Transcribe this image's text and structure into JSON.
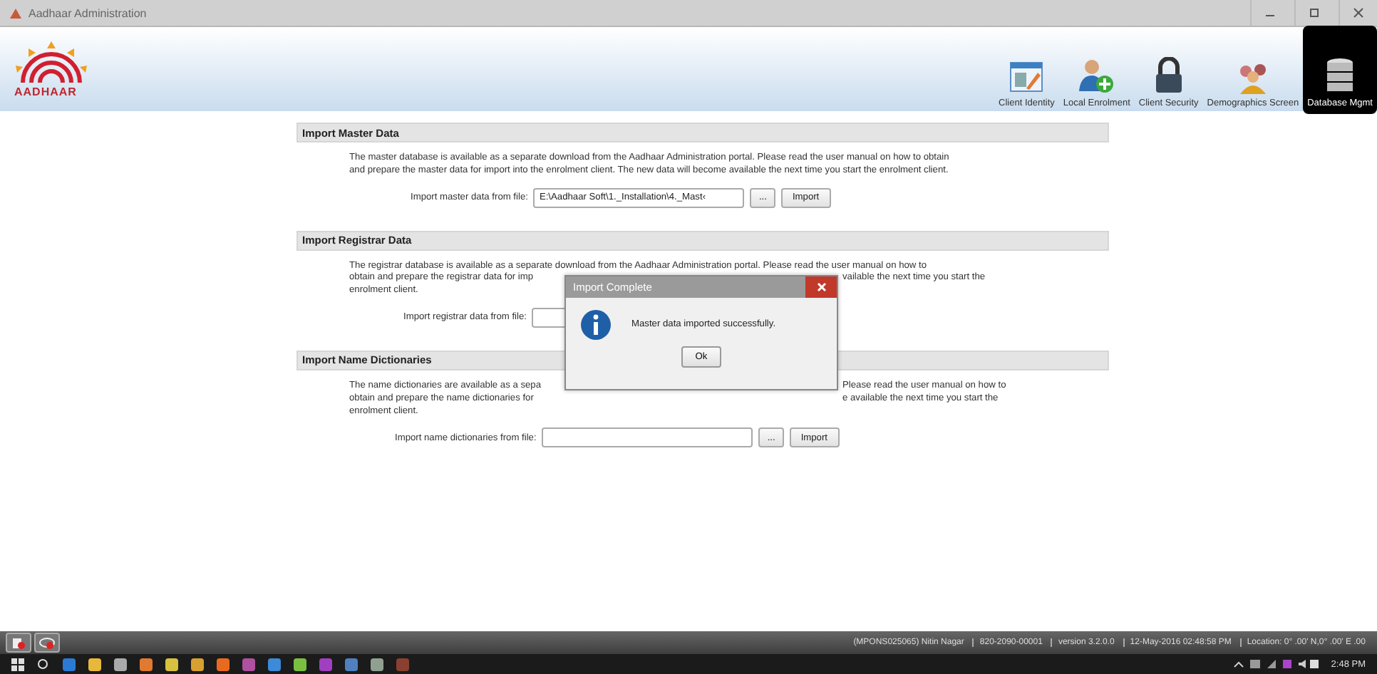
{
  "window": {
    "title": "Aadhaar Administration"
  },
  "logo": {
    "text": "AADHAAR"
  },
  "nav": [
    {
      "label": "Client Identity",
      "selected": false
    },
    {
      "label": "Local Enrolment",
      "selected": false
    },
    {
      "label": "Client Security",
      "selected": false
    },
    {
      "label": "Demographics Screen",
      "selected": false
    },
    {
      "label": "Database Mgmt",
      "selected": true
    }
  ],
  "sections": [
    {
      "title": "Import Master Data",
      "lines": [
        {
          "left": "The master database is available as a separate download from the Aadhaar Administration portal. Please read the user manual on how to obtain"
        },
        {
          "left": "and prepare the master data for import into the enrolment client. The new data will become available the next time you start the enrolment client."
        }
      ],
      "field_label": "Import master data from file:",
      "field_value": "E:\\Aadhaar Soft\\1._Installation\\4._Mast‹",
      "browse": "...",
      "import": "Import"
    },
    {
      "title": "Import Registrar Data",
      "lines": [
        {
          "left": "The registrar database is available as a separate download from the Aadhaar Administration portal. Please read the user manual on how to"
        },
        {
          "left": "obtain and prepare the registrar data for imp",
          "right": "vailable the next time you start the"
        },
        {
          "left": "enrolment client."
        }
      ],
      "field_label": "Import registrar data from file:"
    },
    {
      "title": "Import Name Dictionaries",
      "lines": [
        {
          "left": "The name dictionaries are available as a sepa",
          "right": "Please read the user manual on how to"
        },
        {
          "left": "obtain and prepare the name dictionaries for",
          "right": "e available the next time you start the"
        },
        {
          "left": "enrolment client."
        }
      ],
      "field_label": "Import name dictionaries from file:",
      "browse": "...",
      "import": "Import"
    }
  ],
  "dialog": {
    "title": "Import Complete",
    "message": "Master data imported successfully.",
    "button": "Ok"
  },
  "status_bar": {
    "segments": [
      "(MPONS025065) Nitin Nagar",
      "820-2090-00001",
      "version 3.2.0.0",
      "12-May-2016 02:48:58 PM",
      "Location: 0° .00' N,0° .00' E .00"
    ]
  },
  "taskbar": {
    "clock": "2:48 PM"
  }
}
